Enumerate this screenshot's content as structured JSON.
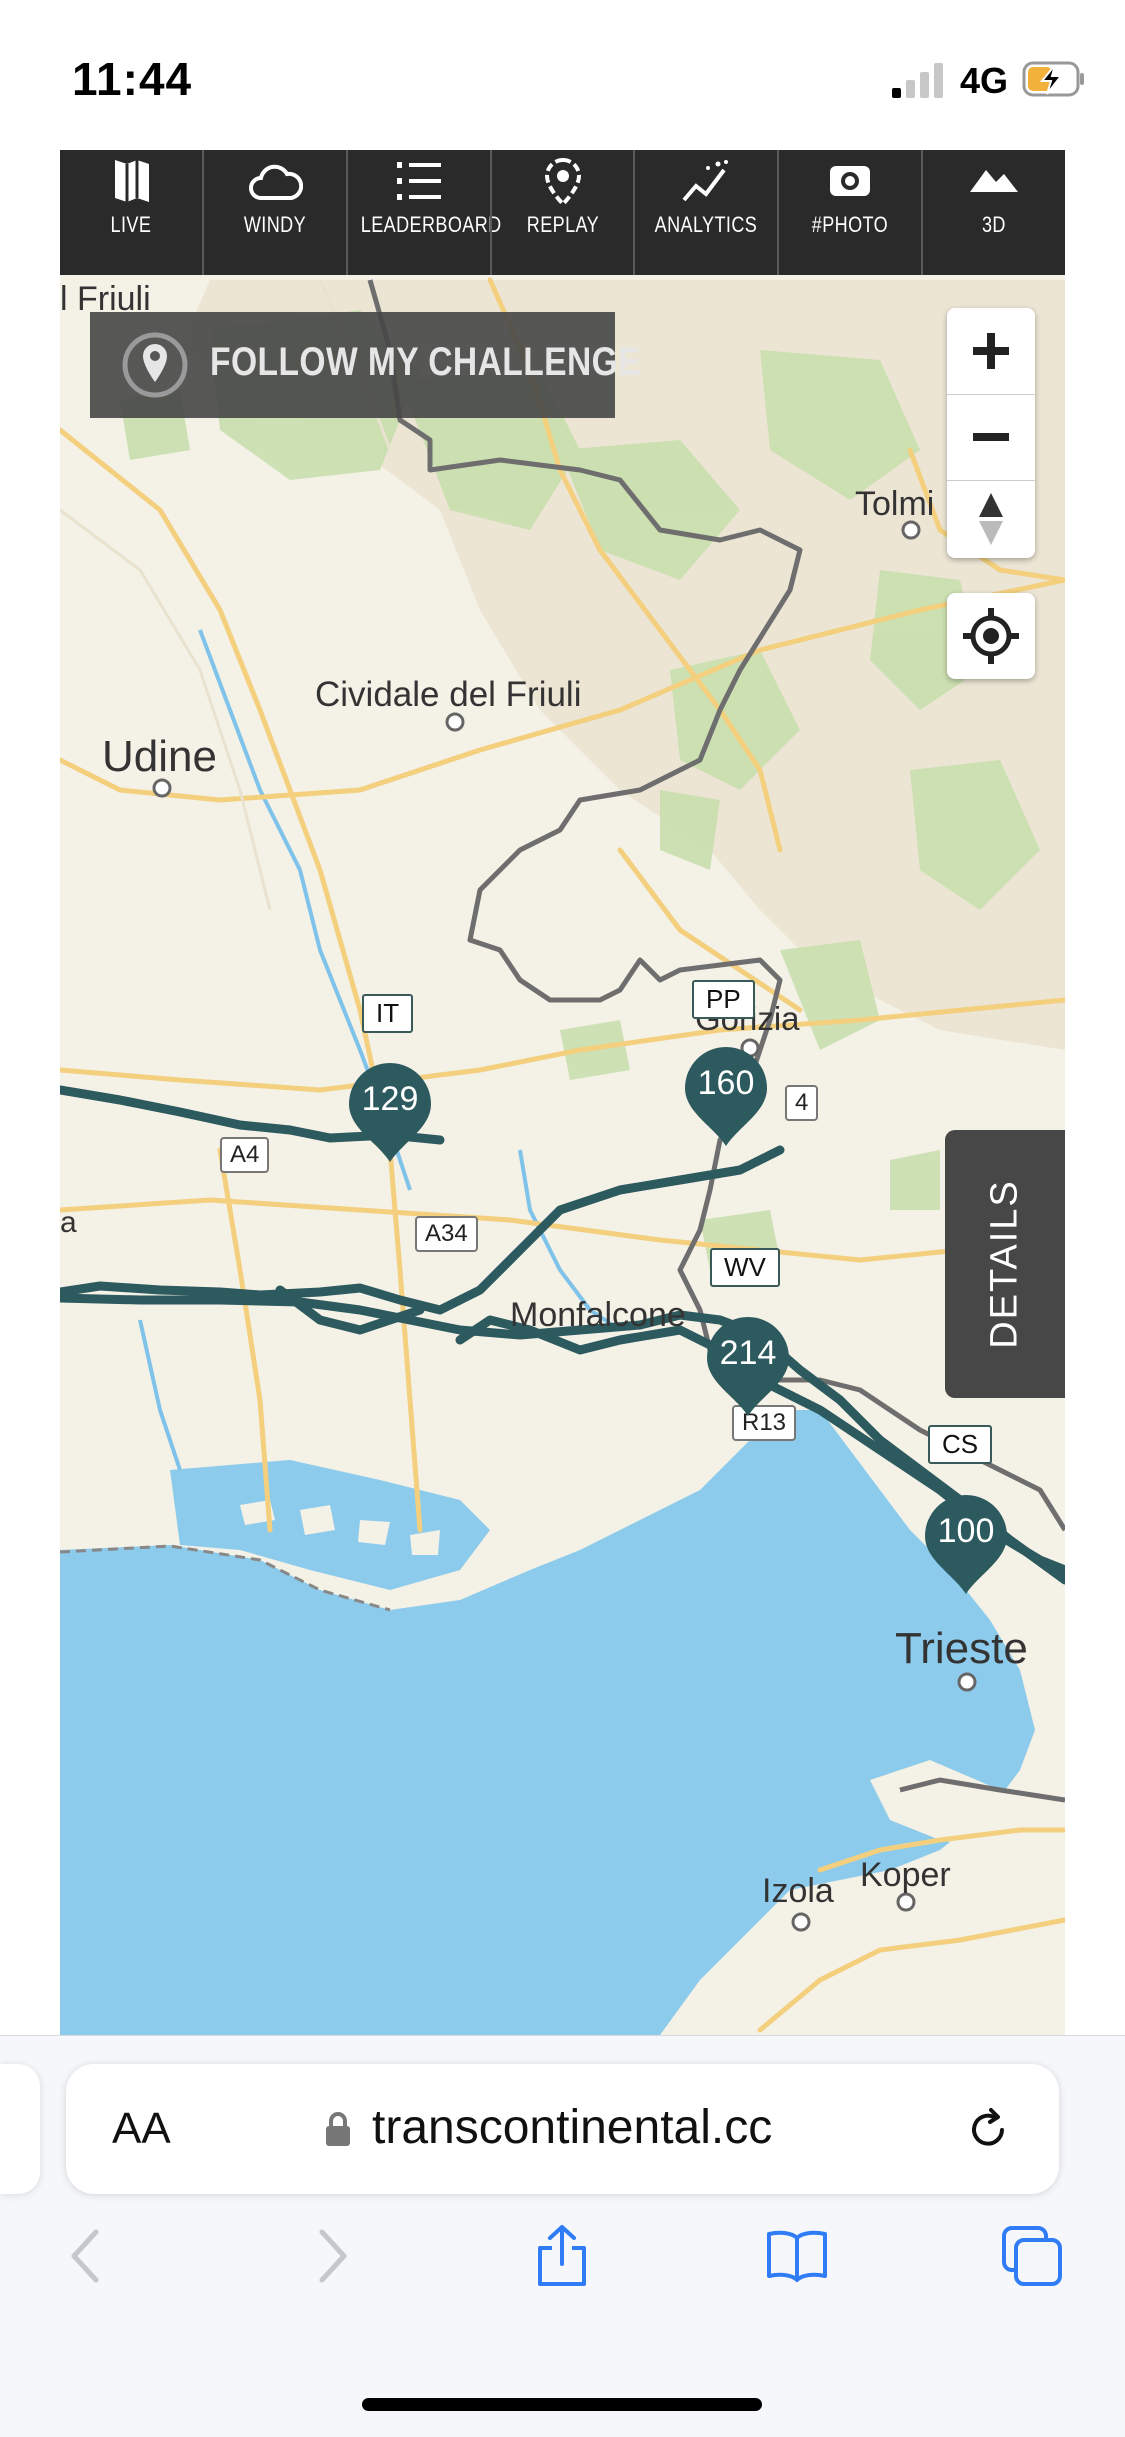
{
  "status_bar": {
    "time": "11:44",
    "network": "4G"
  },
  "nav": {
    "items": [
      {
        "label": "LIVE",
        "icon": "map-icon"
      },
      {
        "label": "WINDY",
        "icon": "cloud-icon"
      },
      {
        "label": "LEADERBOARD",
        "icon": "leaderboard-icon"
      },
      {
        "label": "REPLAY",
        "icon": "replay-pin-icon"
      },
      {
        "label": "ANALYTICS",
        "icon": "analytics-icon"
      },
      {
        "label": "#PHOTO",
        "icon": "camera-icon"
      },
      {
        "label": "3D",
        "icon": "mountain-icon"
      }
    ]
  },
  "follow_button": {
    "label": "FOLLOW MY CHALLENGE"
  },
  "details_tab": {
    "label": "DETAILS"
  },
  "map": {
    "places": {
      "friuli": "l Friuli",
      "tolmin": "Tolmi",
      "cividale": "Cividale del Friuli",
      "udine": "Udine",
      "gorizia": "Gorizia",
      "monfalcone": "Monfalcone",
      "trieste": "Trieste",
      "izola": "Izola",
      "koper": "Koper",
      "edge_a": "a"
    },
    "roads": {
      "a4": "A4",
      "a34": "A34",
      "r13": "R13",
      "r4": "4"
    },
    "rider_labels": {
      "it": "IT",
      "pp": "PP",
      "wv": "WV",
      "cs": "CS"
    },
    "markers": {
      "m129": "129",
      "m160": "160",
      "m214": "214",
      "m100": "100"
    },
    "colors": {
      "land": "#f4f1e6",
      "sea": "#8ccbec",
      "forest": "#c9dfae",
      "track": "#2d5a5e",
      "border": "#6e6e6e",
      "road": "#f3cf7e"
    }
  },
  "safari": {
    "text_size_label": "AA",
    "url": "transcontinental.cc"
  }
}
